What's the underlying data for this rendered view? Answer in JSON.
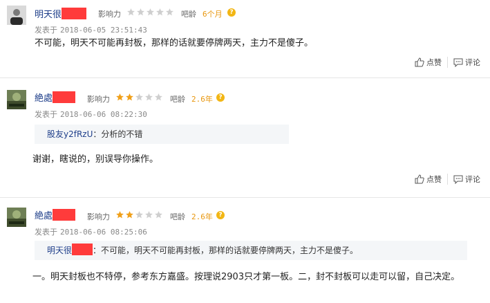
{
  "colors": {
    "link": "#1f3f8a",
    "star_on": "#f0a01a",
    "star_off": "#cfcfcf",
    "redact": "#ff3b3b",
    "badge": "#e8960c"
  },
  "labels": {
    "influence": "影响力",
    "bar_age": "吧龄",
    "posted_at": "发表于",
    "like": "点赞",
    "comment": "评论",
    "colon": "："
  },
  "posts": [
    {
      "username": "明天很",
      "stars_filled": 0,
      "bar_age": "6个月",
      "date": "2018-06-05 23:51:43",
      "content": "不可能，明天不可能再封板，那样的话就要停牌两天，主力不是傻子。"
    },
    {
      "username": "絶處",
      "stars_filled": 2,
      "bar_age": "2.6年",
      "date": "2018-06-06 08:22:30",
      "quote_name": "股友y2fRzU",
      "quote_text": "分析的不错",
      "content": "谢谢，瞎说的，别误导你操作。"
    },
    {
      "username": "絶處",
      "stars_filled": 2,
      "bar_age": "2.6年",
      "date": "2018-06-06 08:25:06",
      "quote_name": "明天很",
      "quote_text": "不可能，明天不可能再封板，那样的话就要停牌两天，主力不是傻子。",
      "content": "一。明天封板也不特停，参考东方嘉盛。按理说2903只才第一板。二，封不封板可以走可以留，自己决定。"
    }
  ]
}
